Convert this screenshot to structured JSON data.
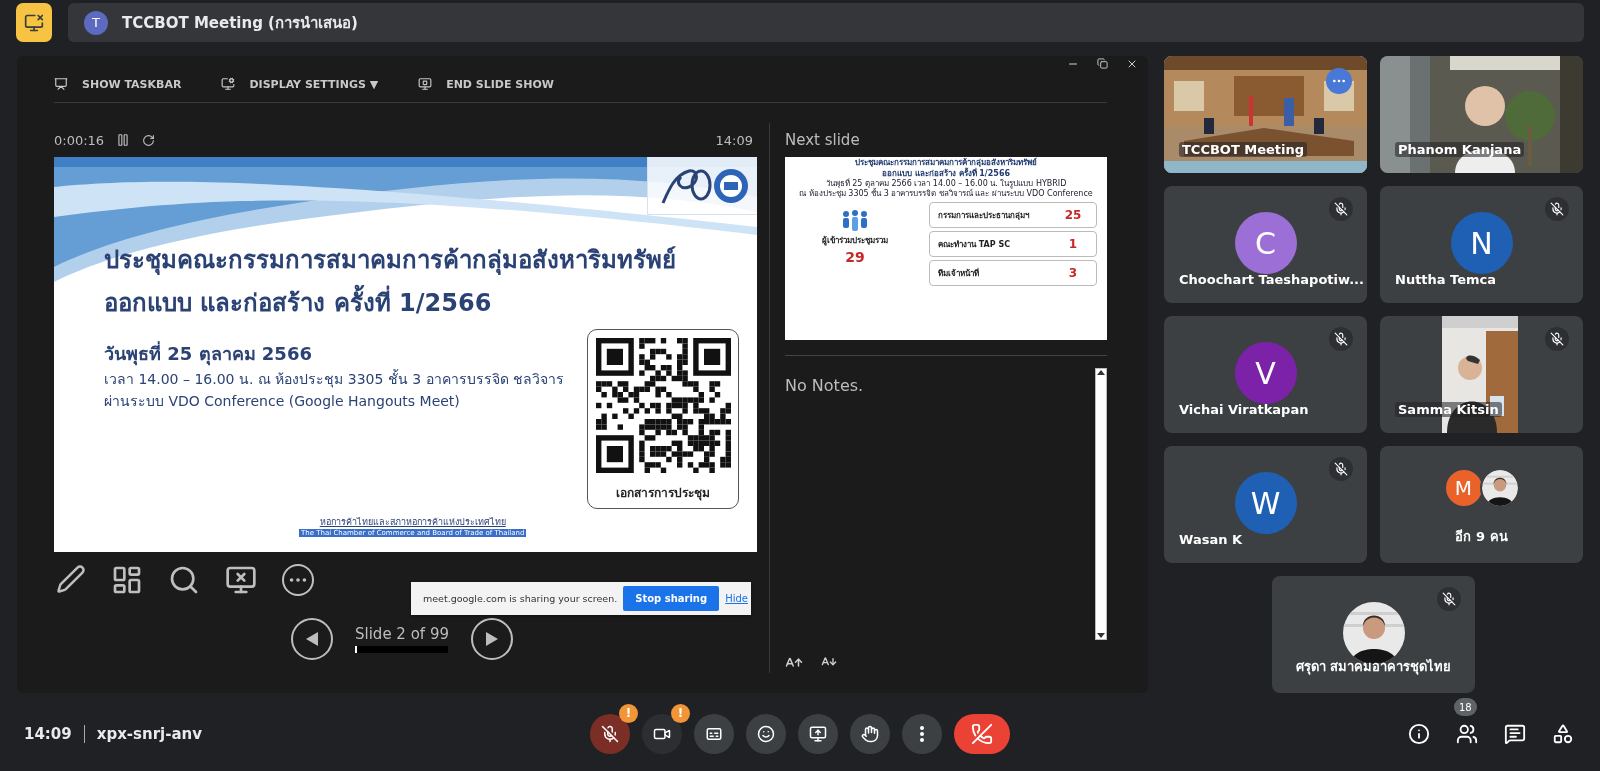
{
  "header": {
    "avatar": "T",
    "title": "TCCBOT Meeting (การนำเสนอ)"
  },
  "presenter": {
    "toolbar": [
      {
        "kind": "taskbar",
        "label": "SHOW TASKBAR"
      },
      {
        "kind": "display",
        "label": "DISPLAY SETTINGS ▼"
      },
      {
        "kind": "end",
        "label": "END SLIDE SHOW"
      }
    ],
    "timer": "0:00:16",
    "clock": "14:09",
    "slide": {
      "title_lines": [
        "ประชุมคณะกรรมการสมาคมการค้ากลุ่มอสังหาริมทรัพย์",
        "ออกแบบ และก่อสร้าง ครั้งที่ 1/2566"
      ],
      "date": "วันพุธที่ 25 ตุลาคม  2566",
      "details": [
        "เวลา 14.00 – 16.00 น.  ณ ห้องประชุม 3305 ชั้น 3 อาคารบรรจิด ชลวิจาร",
        "ผ่านระบบ VDO Conference (Google Hangouts Meet)"
      ],
      "qr_caption": "เอกสารการประชุม",
      "footer": [
        "หอการค้าไทยและสภาหอการค้าแห่งประเทศไทย",
        "The Thai Chamber of Commerce and Board of Trade of Thailand"
      ]
    },
    "counter": "Slide 2 of 99",
    "progress": {
      "level": 0.02
    },
    "next_label": "Next slide",
    "next_slide": {
      "title_lines": [
        "ประชุมคณะกรรมการสมาคมการค้ากลุ่มอสังหาริมทรัพย์",
        "ออกแบบ และก่อสร้าง ครั้งที่ 1/2566"
      ],
      "info_lines": [
        "วันพุธที่ 25 ตุลาคม 2566  เวลา 14.00 – 16.00 น. ในรูปแบบ HYBRID",
        "ณ ห้องประชุม 3305 ชั้น 3 อาคารบรรจิด ชลวิจารณ์  และ ผ่านระบบ VDO Conference"
      ],
      "total_label": "ผู้เข้าร่วมประชุมรวม",
      "total": "29",
      "groups": [
        {
          "label": "กรรมการและประธานกลุ่มฯ",
          "count": "25"
        },
        {
          "label": "คณะทำงาน TAP SC",
          "count": "1"
        },
        {
          "label": "ทีมเจ้าหน้าที่",
          "count": "3"
        }
      ]
    },
    "notes": "No Notes."
  },
  "share_notice": {
    "text": "meet.google.com is sharing your screen.",
    "stop": "Stop sharing",
    "hide": "Hide"
  },
  "participants": [
    {
      "kind": "room_video",
      "name": "TCCBOT Meeting",
      "selected": true,
      "muted": false
    },
    {
      "kind": "person_video",
      "name": "Phanom Kanjana",
      "selected": false,
      "muted": false
    },
    {
      "kind": "avatar",
      "name": "Choochart Taeshapotiw...",
      "initial": "C",
      "color": "#9c6fd6",
      "selected": false,
      "muted": true
    },
    {
      "kind": "avatar",
      "name": "Nuttha Temca",
      "initial": "N",
      "color": "#1f5fb4",
      "selected": false,
      "muted": true
    },
    {
      "kind": "avatar",
      "name": "Vichai Viratkapan",
      "initial": "V",
      "color": "#7b22a8",
      "selected": false,
      "muted": true
    },
    {
      "kind": "portrait_video",
      "name": "Samma Kitsin",
      "selected": false,
      "muted": true
    },
    {
      "kind": "avatar",
      "name": "Wasan K",
      "initial": "W",
      "color": "#1f5fb4",
      "selected": false,
      "muted": true
    },
    {
      "kind": "others",
      "name": "อีก 9 คน",
      "initial": "M",
      "color": "#e8622a",
      "selected": false,
      "muted": false
    },
    {
      "name": "ศรุดา สมาคมอาคารชุดไทย",
      "selected": false,
      "muted": true
    }
  ],
  "footer": {
    "time": "14:09",
    "code": "xpx-snrj-anv",
    "controls": [
      {
        "kind": "mic",
        "alert": "!"
      },
      {
        "kind": "camera",
        "alert": "!"
      },
      {
        "kind": "captions"
      },
      {
        "kind": "emoji"
      },
      {
        "kind": "present"
      },
      {
        "kind": "hand"
      },
      {
        "kind": "more"
      },
      {
        "kind": "leave"
      }
    ],
    "side": [
      {
        "kind": "info"
      },
      {
        "kind": "people",
        "badge": "18"
      },
      {
        "kind": "chat"
      },
      {
        "kind": "activities"
      }
    ]
  }
}
